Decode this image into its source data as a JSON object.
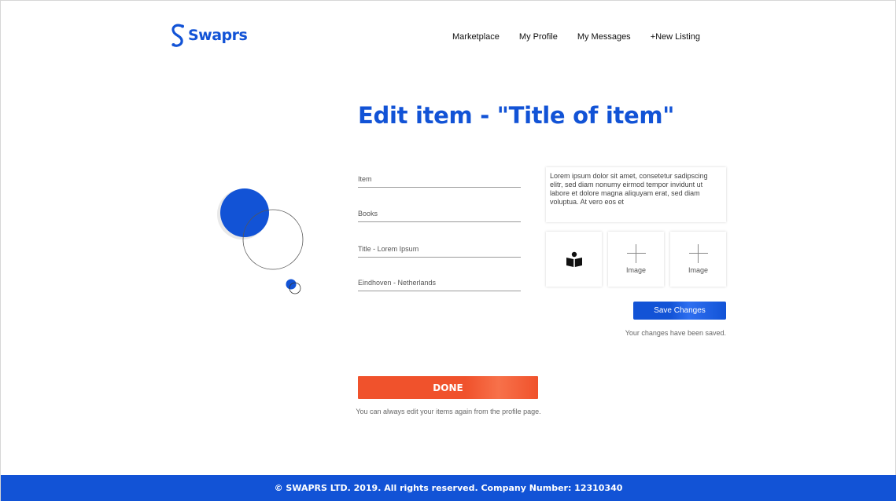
{
  "header": {
    "logo_text": "Swaprs",
    "nav": [
      "Marketplace",
      "My Profile",
      "My Messages",
      "+New Listing"
    ]
  },
  "main": {
    "title": "Edit item - \"Title of item\"",
    "fields": [
      {
        "value": "Item"
      },
      {
        "value": "Books"
      },
      {
        "value": "Title - Lorem Ipsum"
      },
      {
        "value": "Eindhoven - Netherlands"
      }
    ],
    "description": "Lorem ipsum dolor sit amet, consetetur sadipscing elitr, sed diam nonumy eirmod tempor invidunt ut labore et dolore magna aliquyam erat, sed diam voluptua. At vero eos et",
    "images": [
      {
        "icon": "book-reader-icon"
      },
      {
        "label": "Image",
        "icon": "plus-icon"
      },
      {
        "label": "Image",
        "icon": "plus-icon"
      }
    ],
    "save_label": "Save Changes",
    "saved_message": "Your changes have been saved.",
    "done_label": "DONE",
    "done_note": "You can always edit your items again from the profile page."
  },
  "footer": {
    "text": "© SWAPRS LTD. 2019. All rights reserved. Company Number: 12310340"
  },
  "colors": {
    "brand_blue": "#1253d6",
    "accent_orange": "#f0522c"
  }
}
